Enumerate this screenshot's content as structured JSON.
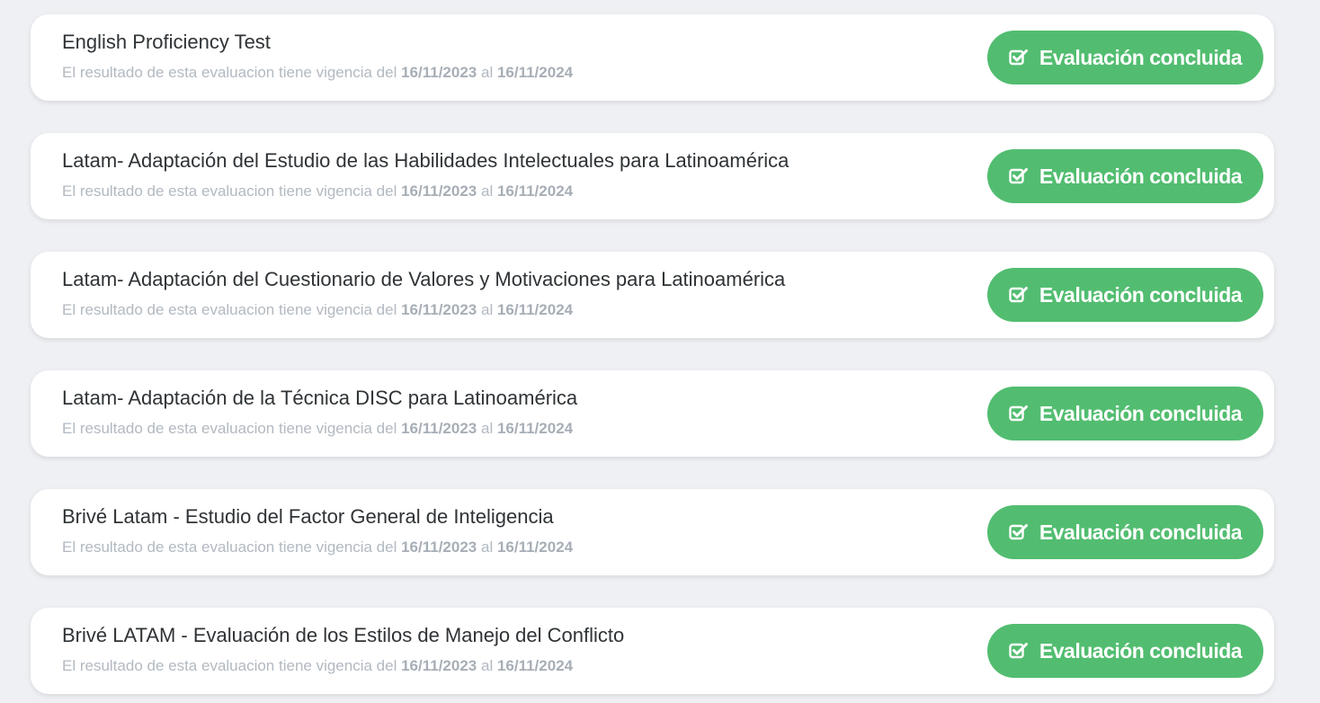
{
  "colors": {
    "background": "#eff0f4",
    "card": "#ffffff",
    "status_button": "#52bd70",
    "title_text": "#2f3336",
    "subtitle_text": "#b2b9c1"
  },
  "evaluations": [
    {
      "title": "English Proficiency Test",
      "validity_prefix": "El resultado de esta evaluacion tiene vigencia del",
      "start_date": "16/11/2023",
      "joiner": "al",
      "end_date": "16/11/2024",
      "status_label": "Evaluación concluida",
      "status_icon": "check-square-icon"
    },
    {
      "title": "Latam- Adaptación del Estudio de las Habilidades Intelectuales para Latinoamérica",
      "validity_prefix": "El resultado de esta evaluacion tiene vigencia del",
      "start_date": "16/11/2023",
      "joiner": "al",
      "end_date": "16/11/2024",
      "status_label": "Evaluación concluida",
      "status_icon": "check-square-icon"
    },
    {
      "title": "Latam- Adaptación del Cuestionario de Valores y Motivaciones para Latinoamérica",
      "validity_prefix": "El resultado de esta evaluacion tiene vigencia del",
      "start_date": "16/11/2023",
      "joiner": "al",
      "end_date": "16/11/2024",
      "status_label": "Evaluación concluida",
      "status_icon": "check-square-icon"
    },
    {
      "title": "Latam- Adaptación de la Técnica DISC para Latinoamérica",
      "validity_prefix": "El resultado de esta evaluacion tiene vigencia del",
      "start_date": "16/11/2023",
      "joiner": "al",
      "end_date": "16/11/2024",
      "status_label": "Evaluación concluida",
      "status_icon": "check-square-icon"
    },
    {
      "title": "Brivé Latam - Estudio del Factor General de Inteligencia",
      "validity_prefix": "El resultado de esta evaluacion tiene vigencia del",
      "start_date": "16/11/2023",
      "joiner": "al",
      "end_date": "16/11/2024",
      "status_label": "Evaluación concluida",
      "status_icon": "check-square-icon"
    },
    {
      "title": "Brivé LATAM - Evaluación de los Estilos de Manejo del Conflicto",
      "validity_prefix": "El resultado de esta evaluacion tiene vigencia del",
      "start_date": "16/11/2023",
      "joiner": "al",
      "end_date": "16/11/2024",
      "status_label": "Evaluación concluida",
      "status_icon": "check-square-icon"
    }
  ]
}
